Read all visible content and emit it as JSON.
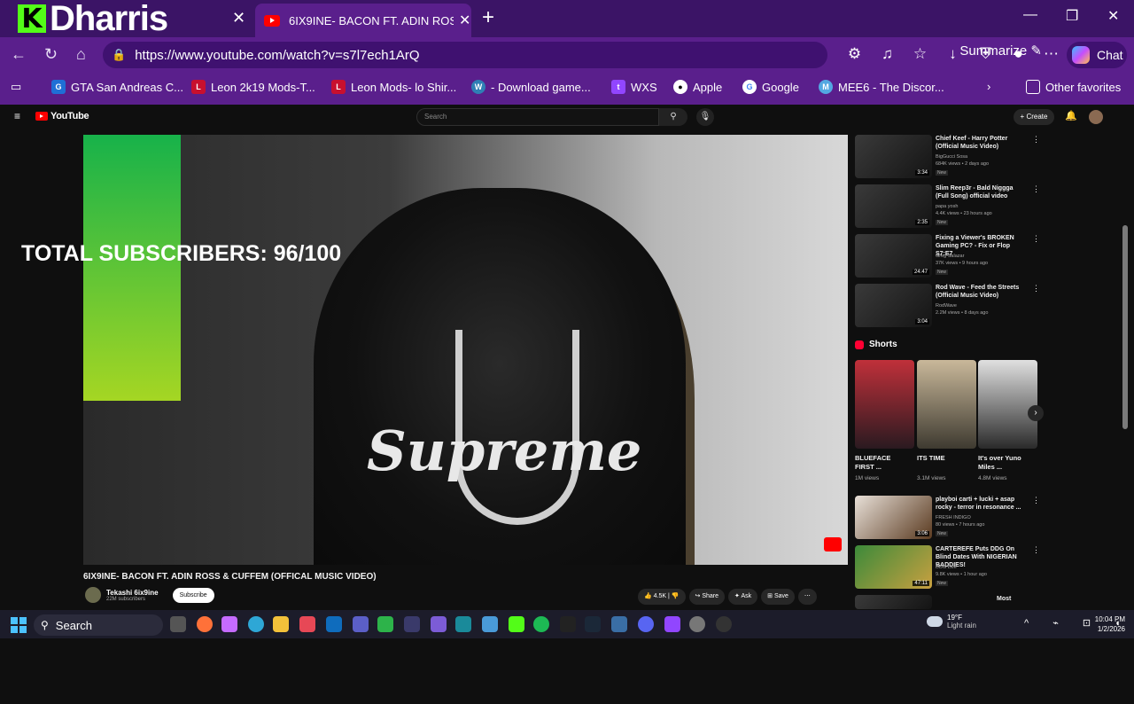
{
  "browser": {
    "streamer_logo_letter": "K",
    "streamer_name": "Dharris",
    "active_tab_title": "6IX9INE- BACON FT. ADIN ROSS & CUFFEM",
    "url": "https://www.youtube.com/watch?v=s7l7ech1ArQ",
    "summarize_label": "Summarize",
    "chat_label": "Chat",
    "favorites": [
      {
        "label": "GTA San Andreas C...",
        "icon": "gpm-icon",
        "color": "#1f6fd6"
      },
      {
        "label": "Leon 2k19 Mods-T...",
        "icon": "leon-icon",
        "color": "#c8102e"
      },
      {
        "label": "Leon Mods- lo Shir...",
        "icon": "leon-icon",
        "color": "#c8102e"
      },
      {
        "label": "- Download game...",
        "icon": "wordpress-icon",
        "color": "#2f7fb5"
      },
      {
        "label": "WXS",
        "icon": "twitch-icon",
        "color": "#9146ff"
      },
      {
        "label": "Apple",
        "icon": "apple-icon",
        "color": "#111111"
      },
      {
        "label": "Google",
        "icon": "google-icon",
        "color": "#ffffff"
      },
      {
        "label": "MEE6 - The Discor...",
        "icon": "mee6-icon",
        "color": "#53a8e2"
      }
    ],
    "other_favorites": "Other favorites"
  },
  "youtube": {
    "logo_text": "YouTube",
    "search_placeholder": "Search",
    "create_label": "+ Create",
    "overlay_text": "TOTAL SUBSCRIBERS: 96/100",
    "video_title": "6IX9INE- BACON FT. ADIN ROSS & CUFFEM (OFFICAL MUSIC VIDEO)",
    "channel_name": "Tekashi 6ix9ine",
    "channel_subs": "22M subscribers",
    "subscribe_label": "Subscribe",
    "likes": "4.5K",
    "share_label": "Share",
    "ask_label": "Ask",
    "save_label": "Save",
    "recommended": [
      {
        "title": "Chief Keef - Harry Potter (Official Music Video)",
        "channel": "BigGucci Sosa",
        "meta": "684K views • 2 days ago",
        "duration": "3:34",
        "new": "New"
      },
      {
        "title": "Slim Reep3r - Bald Niggga (Full Song) official video",
        "channel": "papa yosh",
        "meta": "4.4K views • 23 hours ago",
        "duration": "2:35",
        "new": "New"
      },
      {
        "title": "Fixing a Viewer's BROKEN Gaming PC? - Fix or Flop S7:E7",
        "channel": "Greg Salazar",
        "meta": "37K views • 9 hours ago",
        "duration": "24:47",
        "new": "New"
      },
      {
        "title": "Rod Wave - Feed the Streets (Official Music Video)",
        "channel": "RodWave",
        "meta": "2.2M views • 8 days ago",
        "duration": "3:04",
        "new": ""
      }
    ],
    "shorts_heading": "Shorts",
    "shorts": [
      {
        "title": "BLUEFACE FIRST ...",
        "views": "1M views"
      },
      {
        "title": "ITS TIME",
        "views": "3.1M views"
      },
      {
        "title": "It's over Yuno Miles ...",
        "views": "4.8M views"
      }
    ],
    "more_videos": [
      {
        "title": "playboi carti + lucki + asap rocky - terror in resonance ...",
        "channel": "FRESH INDIGO",
        "meta": "80 views • 7 hours ago",
        "duration": "3:06",
        "new": "New"
      },
      {
        "title": "CARTEREFE Puts DDG On Blind Dates With NIGERIAN BADDIES!",
        "channel": "DDG Live",
        "meta": "9.8K views • 1 hour ago",
        "duration": "47:11",
        "new": "New"
      },
      {
        "title": "Most",
        "channel": "",
        "meta": "",
        "duration": "",
        "new": ""
      }
    ]
  },
  "taskbar": {
    "search_label": "Search",
    "weather_temp": "19°F",
    "weather_desc": "Light rain",
    "time": "10:04 PM",
    "date": "1/2/2026"
  }
}
